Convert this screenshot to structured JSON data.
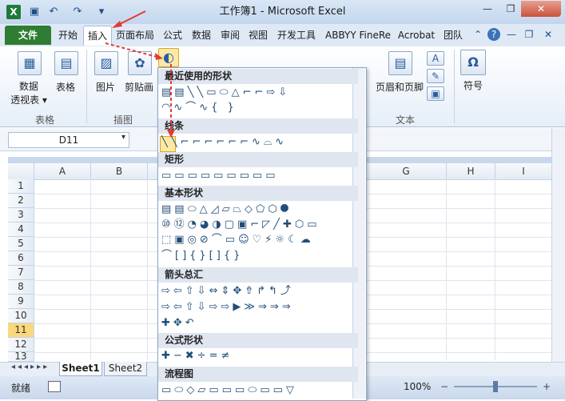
{
  "window": {
    "title": "工作簿1 - Microsoft Excel",
    "app_icon": "X",
    "quick_access": [
      "save-icon",
      "undo-icon",
      "redo-icon",
      "customize-icon"
    ],
    "controls": [
      "—",
      "❐",
      "✕"
    ]
  },
  "tabs": [
    "文件",
    "开始",
    "插入",
    "页面布局",
    "公式",
    "数据",
    "审阅",
    "视图",
    "开发工具",
    "ABBYY FineRe",
    "Acrobat",
    "团队"
  ],
  "ribbon": {
    "groups": [
      {
        "label": "表格",
        "buttons": [
          "数据\n透视表 ▾",
          "表格"
        ]
      },
      {
        "label": "插图",
        "buttons": [
          "图片",
          "剪贴画"
        ]
      },
      {
        "label": "文本",
        "buttons": [
          "页眉和页脚"
        ]
      }
    ],
    "symbol_button": "符号",
    "symbol_glyph": "Ω"
  },
  "formula_bar": {
    "namebox": "D11",
    "namebox_arrow": "▾"
  },
  "grid": {
    "columns": [
      "A",
      "B",
      "G",
      "H",
      "I"
    ],
    "rows": [
      "1",
      "2",
      "3",
      "4",
      "5",
      "6",
      "7",
      "8",
      "9",
      "10",
      "11",
      "12",
      "13"
    ],
    "selected_row": "11"
  },
  "sheets": [
    "Sheet1",
    "Sheet2"
  ],
  "status": {
    "text": "就绪",
    "zoom": "100%"
  },
  "shapes_menu": {
    "sections": [
      {
        "title": "最近使用的形状",
        "rows": [
          "▤▤╲╲▭⬭△⌐⌐⇨⇩",
          "◠∿⌒∿{ }"
        ]
      },
      {
        "title": "线条",
        "rows": [
          "╲╲⌐⌐⌐⌐⌐⌐∿⌓∿"
        ]
      },
      {
        "title": "矩形",
        "rows": [
          "▭▭▭▭▭▭▭▭▭"
        ]
      },
      {
        "title": "基本形状",
        "rows": [
          "▤▤⬭△◿▱⏢◇⬠⬡⯃",
          "⑩⑫◔◕◑▢▣⌐◸╱✚⬡▭",
          "⬚▣◎⊘⌒▭☺♡⚡☼☾☁",
          "⌒[]{}[]{}"
        ]
      },
      {
        "title": "箭头总汇",
        "rows": [
          "⇨⇦⇧⇩⇔⇕✥⇮↱↰⤴",
          "⇨⇦⇧⇩⇨⇨▶≫⇒⇒⇒",
          "✚✥↶"
        ]
      },
      {
        "title": "公式形状",
        "rows": [
          "✚−✖÷=≠"
        ]
      },
      {
        "title": "流程图",
        "rows": [
          "▭⬭◇▱▭▭▭⬭▭▭▽"
        ]
      }
    ]
  }
}
